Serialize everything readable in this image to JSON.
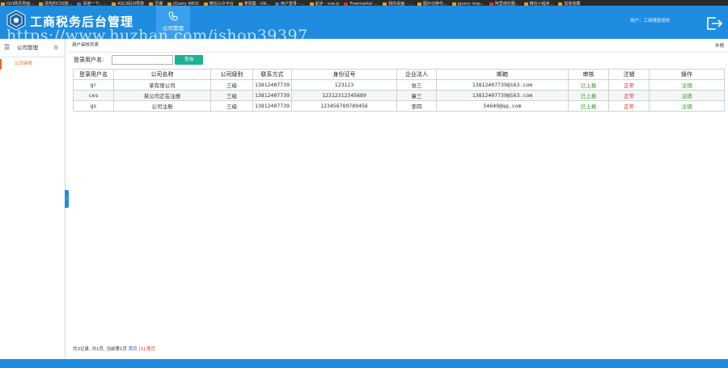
{
  "bookmarks": [
    {
      "label": "QUI网页界面...",
      "tone": "orange"
    },
    {
      "label": "漂亮的CSS按...",
      "tone": "orange"
    },
    {
      "label": "百度一下，...",
      "tone": "blue"
    },
    {
      "label": "ASCII码对照表",
      "tone": "orange"
    },
    {
      "label": "豆瓣",
      "tone": "orange"
    },
    {
      "label": "jQuery WEUI",
      "tone": "orange"
    },
    {
      "label": "微信公众平台",
      "tone": "orange"
    },
    {
      "label": "表情集 - UN...",
      "tone": "orange"
    },
    {
      "label": "用户登录 - ...",
      "tone": "blue"
    },
    {
      "label": "起步 - vue.js",
      "tone": "orange"
    },
    {
      "label": "Freemarker ...",
      "tone": "red"
    },
    {
      "label": "我的桌面 - ...",
      "tone": "orange"
    },
    {
      "label": "图片切换代...",
      "tone": "orange"
    },
    {
      "label": "jquery resp...",
      "tone": "orange"
    },
    {
      "label": "阿里通信圈...",
      "tone": "red"
    },
    {
      "label": "微信小程序...",
      "tone": "orange"
    },
    {
      "label": "其他收藏",
      "tone": "orange"
    }
  ],
  "header": {
    "title": "工商税务后台管理",
    "nav_module": "公司管理",
    "user_info": "用户：工商稽查组外"
  },
  "watermark": "https://www.huzhan.com/ishop39397",
  "sidebar": {
    "title": "公司管理",
    "items": [
      {
        "label": "公司审核",
        "active": true
      }
    ]
  },
  "main": {
    "breadcrumb": "用户审核列表",
    "right_link": "补报",
    "search": {
      "label": "登录用户名:",
      "placeholder": "",
      "value": "",
      "button": "查询"
    },
    "columns": [
      "登录用户名",
      "公司名称",
      "公司级别",
      "联系方式",
      "身份证号",
      "企业法人",
      "邮箱",
      "审核",
      "注销",
      "操作"
    ],
    "rows": [
      {
        "username": "gr",
        "company": "某有限公司",
        "level": "三级",
        "phone": "13812407739",
        "id_no": "123123",
        "legal": "张三",
        "email": "13812407739@163.com",
        "audit": "已上报",
        "cancel": "正常",
        "action": "注销"
      },
      {
        "username": "ces",
        "company": "某公司正在注册",
        "level": "三级",
        "phone": "13812407739",
        "id_no": "12312312345689",
        "legal": "童三",
        "email": "13812407739@163.com",
        "audit": "已上报",
        "cancel": "正常",
        "action": "注销"
      },
      {
        "username": "gs",
        "company": "公司注册",
        "level": "三级",
        "phone": "13812407739",
        "id_no": "123456789789456",
        "legal": "李四",
        "email": "54649@qq.com",
        "audit": "已上报",
        "cancel": "正常",
        "action": "注销"
      }
    ],
    "pager": {
      "summary": "共3记录, 共1页, 当前第1页",
      "first": "首页",
      "current": "[1]",
      "last": "尾页"
    }
  },
  "colors": {
    "primary": "#1f8ce0",
    "accent_green": "#1ab394",
    "active_orange": "#e46c13",
    "status_green": "#2ba020",
    "status_red": "#e03030"
  }
}
